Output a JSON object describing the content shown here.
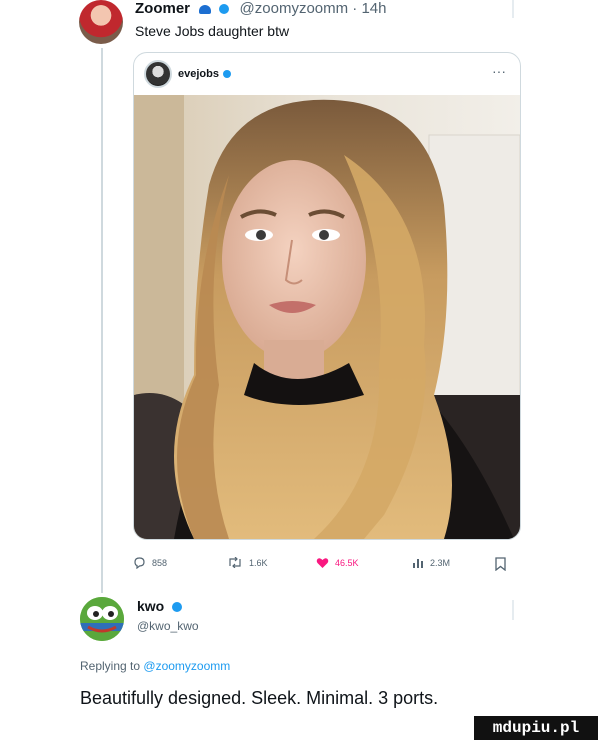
{
  "tweet": {
    "author_name": "Zoomer",
    "handle": "@zoomyzoomm",
    "dot": "·",
    "time": "14h",
    "text": "Steve Jobs daughter btw"
  },
  "quote": {
    "author_name": "evejobs",
    "more": "···"
  },
  "actions": {
    "replies": "858",
    "retweets": "1.6K",
    "likes": "46.5K",
    "views": "2.3M"
  },
  "reply": {
    "author_name": "kwo",
    "handle": "@kwo_kwo",
    "replying_prefix": "Replying to",
    "replying_to": "@zoomyzoomm",
    "text": "Beautifully designed. Sleek. Minimal. 3 ports."
  },
  "watermark": "mdupiu.pl",
  "colors": {
    "accent": "#1d9bf0",
    "like": "#f91880",
    "muted": "#536471"
  }
}
